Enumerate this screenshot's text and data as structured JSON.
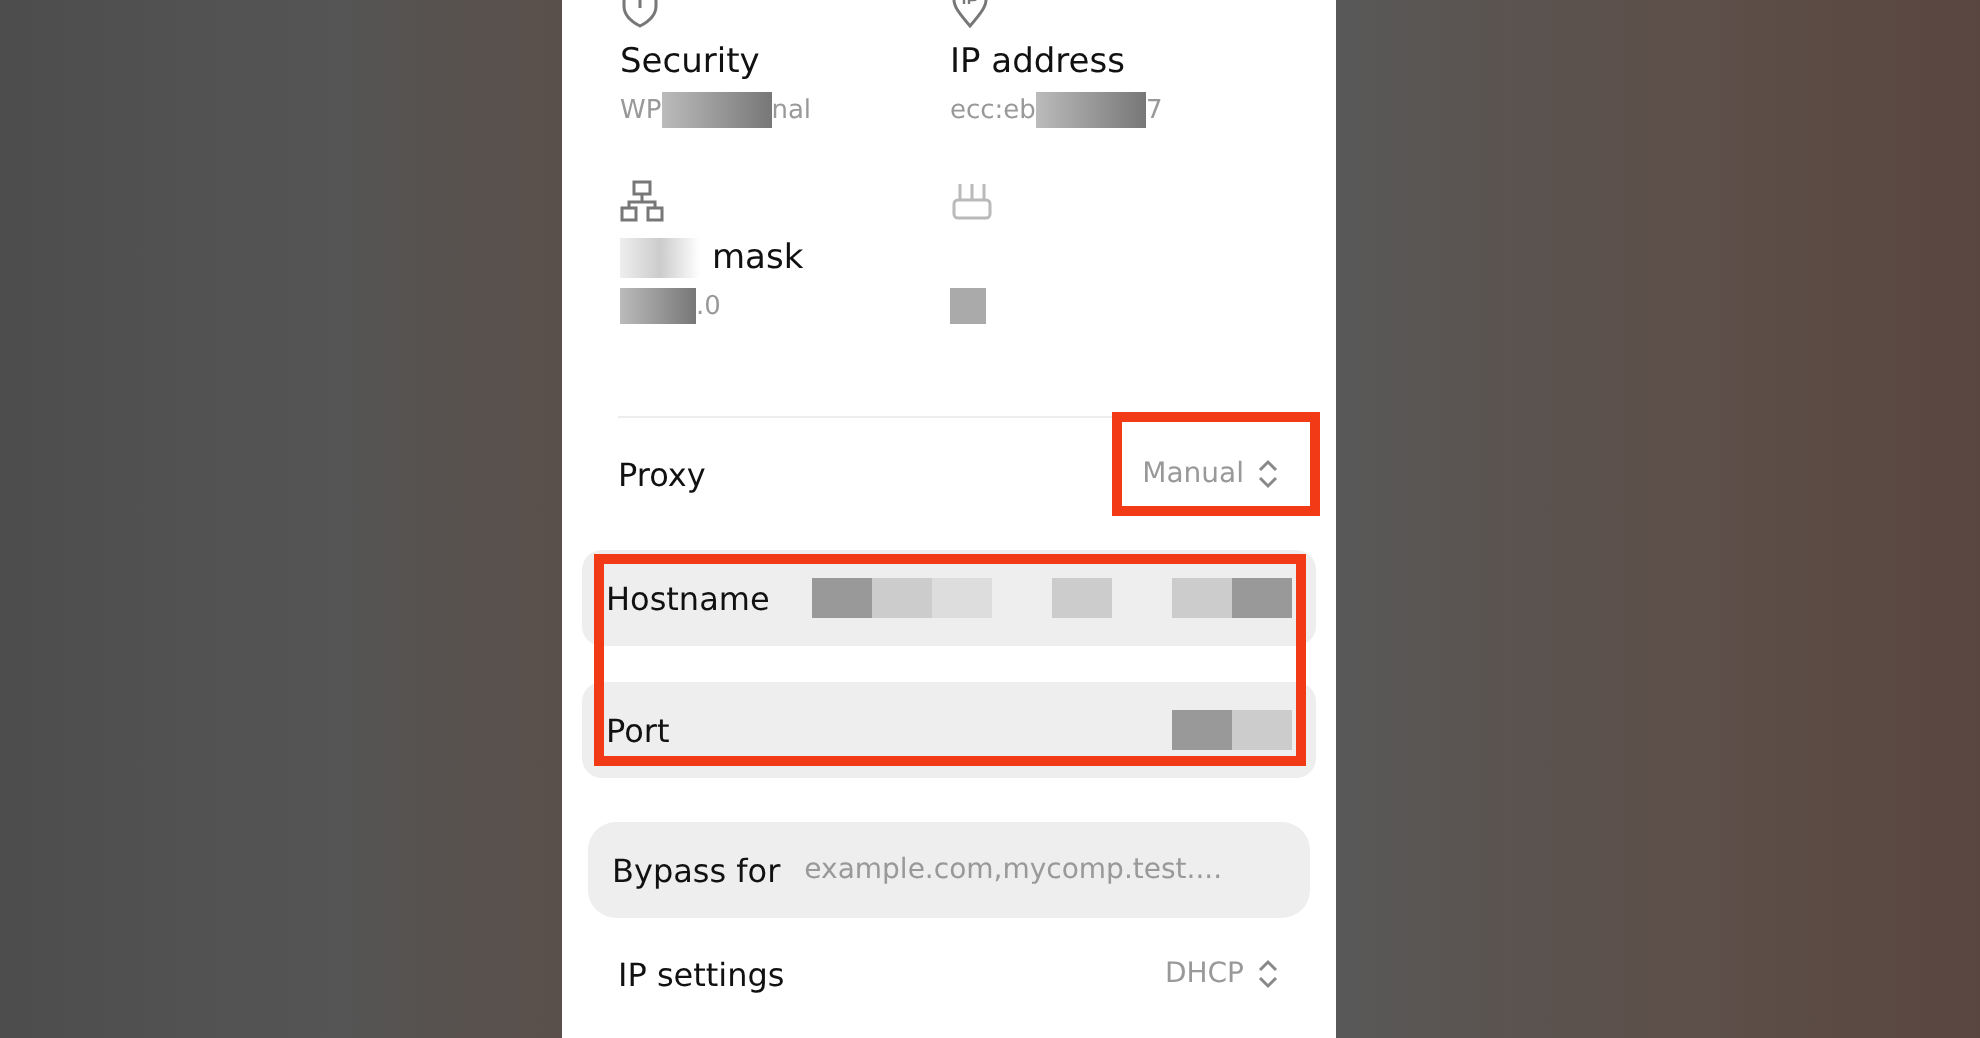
{
  "info_grid": [
    {
      "kind": "shield",
      "label_parts": [
        "Security"
      ],
      "value_parts": [
        "WP",
        "nal"
      ]
    },
    {
      "kind": "pin",
      "label_parts": [
        "IP address"
      ],
      "value_parts": [
        "ecc:eb",
        "7"
      ]
    },
    {
      "kind": "network",
      "label_parts": [
        "mask"
      ],
      "value_parts": [
        ".0"
      ]
    },
    {
      "kind": "router"
    }
  ],
  "proxy": {
    "label": "Proxy",
    "value": "Manual"
  },
  "proxy_fields": [
    {
      "label": "Hostname"
    },
    {
      "label": "Port"
    }
  ],
  "bypass": {
    "label": "Bypass for",
    "placeholder": "example.com,mycomp.test...."
  },
  "ip_settings": {
    "label": "IP settings",
    "value": "DHCP"
  }
}
